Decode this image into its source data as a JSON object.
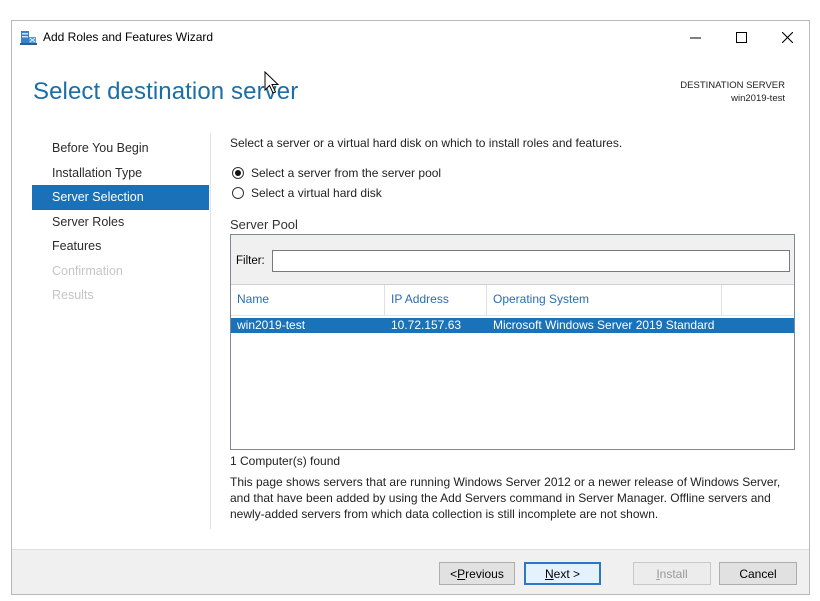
{
  "window": {
    "title": "Add Roles and Features Wizard",
    "icons": {
      "app": "server-wizard-icon",
      "minimize": "minimize-icon",
      "maximize": "maximize-icon",
      "close": "close-icon"
    }
  },
  "header": {
    "page_title": "Select destination server",
    "destination_label": "DESTINATION SERVER",
    "destination_server": "win2019-test"
  },
  "nav": {
    "items": [
      {
        "label": "Before You Begin",
        "state": "normal"
      },
      {
        "label": "Installation Type",
        "state": "normal"
      },
      {
        "label": "Server Selection",
        "state": "active"
      },
      {
        "label": "Server Roles",
        "state": "normal"
      },
      {
        "label": "Features",
        "state": "normal"
      },
      {
        "label": "Confirmation",
        "state": "disabled"
      },
      {
        "label": "Results",
        "state": "disabled"
      }
    ]
  },
  "content": {
    "instruction": "Select a server or a virtual hard disk on which to install roles and features.",
    "options": [
      {
        "label": "Select a server from the server pool",
        "checked": true
      },
      {
        "label": "Select a virtual hard disk",
        "checked": false
      }
    ],
    "pool_title": "Server Pool",
    "filter_label": "Filter:",
    "filter_value": "",
    "columns": [
      "Name",
      "IP Address",
      "Operating System"
    ],
    "rows": [
      {
        "name": "win2019-test",
        "ip": "10.72.157.63",
        "os": "Microsoft Windows Server 2019 Standard",
        "selected": true
      }
    ],
    "found": "1 Computer(s) found",
    "description_lines": [
      "This page shows servers that are running Windows Server 2012 or a newer release of Windows Server,",
      "and that have been added by using the Add Servers command in Server Manager. Offline servers and",
      "newly-added servers from which data collection is still incomplete are not shown."
    ]
  },
  "footer": {
    "previous": {
      "prefix": "< ",
      "accel": "P",
      "rest": "revious"
    },
    "next": {
      "accel": "N",
      "rest": "ext >"
    },
    "install": {
      "accel": "I",
      "rest": "nstall"
    },
    "cancel": "Cancel"
  },
  "colors": {
    "accent": "#1a71b8",
    "title_blue": "#1a6fa8",
    "header_link": "#2a6db0"
  }
}
